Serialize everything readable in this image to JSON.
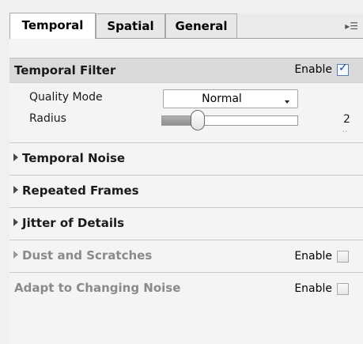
{
  "tabs": [
    {
      "label": "Temporal",
      "active": true
    },
    {
      "label": "Spatial",
      "active": false
    },
    {
      "label": "General",
      "active": false
    }
  ],
  "flyout_icon": "panel-menu-icon",
  "temporal_filter": {
    "title": "Temporal Filter",
    "enable_label": "Enable",
    "enabled": true,
    "quality_mode": {
      "label": "Quality Mode",
      "value": "Normal"
    },
    "radius": {
      "label": "Radius",
      "value": "2",
      "level": 0.25
    }
  },
  "sections": [
    {
      "title": "Temporal Noise",
      "collapsed": true,
      "disabled": false
    },
    {
      "title": "Repeated Frames",
      "collapsed": true,
      "disabled": false
    },
    {
      "title": "Jitter of Details",
      "collapsed": true,
      "disabled": false
    },
    {
      "title": "Dust and Scratches",
      "collapsed": true,
      "disabled": true,
      "enable_label": "Enable",
      "enabled": false
    },
    {
      "title": "Adapt to Changing Noise",
      "disabled": true,
      "enable_label": "Enable",
      "enabled": false
    }
  ],
  "colors": {
    "header_bg": "#dadada",
    "check_accent": "#1a46a8",
    "muted_text": "#8a8a8a"
  }
}
